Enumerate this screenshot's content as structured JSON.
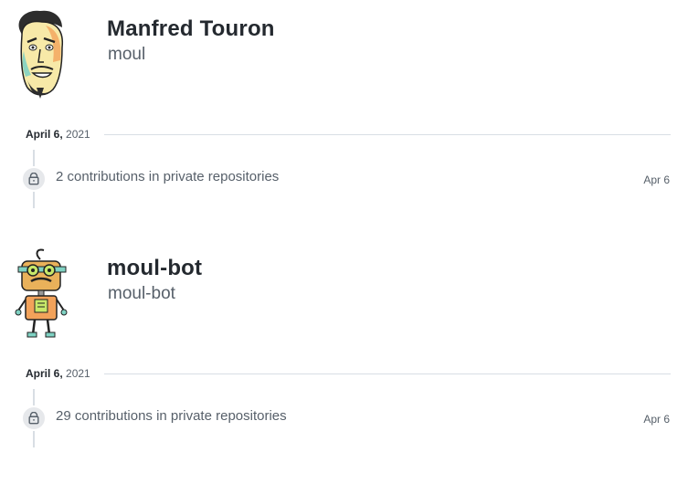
{
  "profiles": [
    {
      "name": "Manfred Touron",
      "login": "moul",
      "activity": {
        "date_month_day": "April 6,",
        "date_year": "2021",
        "contributions_count": "2",
        "contributions_text": "contributions in private repositories",
        "item_date": "Apr 6",
        "icon": "lock-icon"
      }
    },
    {
      "name": "moul-bot",
      "login": "moul-bot",
      "activity": {
        "date_month_day": "April 6,",
        "date_year": "2021",
        "contributions_count": "29",
        "contributions_text": "contributions in private repositories",
        "item_date": "Apr 6",
        "icon": "lock-icon"
      }
    }
  ],
  "colors": {
    "text_primary": "#24292f",
    "text_muted": "#57606a",
    "timeline": "#d8dee4",
    "badge_bg": "#e6e8eb"
  }
}
